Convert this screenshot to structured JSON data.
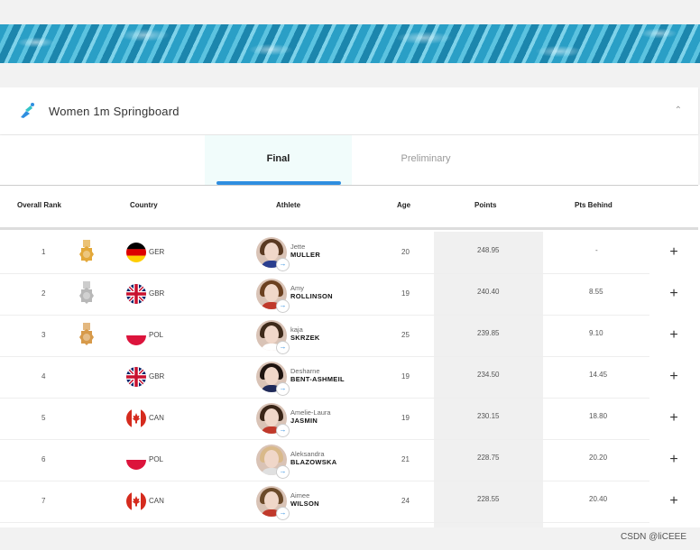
{
  "event": {
    "title": "Women 1m Springboard",
    "icon": "diving-icon",
    "collapse_icon": "chevron-up-icon"
  },
  "tabs": [
    {
      "label": "Final",
      "active": true
    },
    {
      "label": "Preliminary",
      "active": false
    }
  ],
  "table": {
    "headers": {
      "rank": "Overall Rank",
      "country": "Country",
      "athlete": "Athlete",
      "age": "Age",
      "points": "Points",
      "behind": "Pts Behind"
    },
    "rows": [
      {
        "rank": "1",
        "medal": "gold",
        "flag": "GER",
        "country": "GER",
        "first": "Jette",
        "last": "MULLER",
        "age": "20",
        "points": "248.95",
        "behind": "-",
        "hair": "#5a3a22",
        "shirt": "#2b3f8f"
      },
      {
        "rank": "2",
        "medal": "silver",
        "flag": "GBR",
        "country": "GBR",
        "first": "Amy",
        "last": "ROLLINSON",
        "age": "19",
        "points": "240.40",
        "behind": "8.55",
        "hair": "#6b4020",
        "shirt": "#c0392b"
      },
      {
        "rank": "3",
        "medal": "bronze",
        "flag": "POL",
        "country": "POL",
        "first": "kaja",
        "last": "SKRZEK",
        "age": "25",
        "points": "239.85",
        "behind": "9.10",
        "hair": "#3e2a1a",
        "shirt": "#ffffff"
      },
      {
        "rank": "4",
        "medal": "",
        "flag": "GBR",
        "country": "GBR",
        "first": "Desharne",
        "last": "BENT-ASHMEIL",
        "age": "19",
        "points": "234.50",
        "behind": "14.45",
        "hair": "#1e1410",
        "shirt": "#1f2a5a"
      },
      {
        "rank": "5",
        "medal": "",
        "flag": "CAN",
        "country": "CAN",
        "first": "Amelie-Laura",
        "last": "JASMIN",
        "age": "19",
        "points": "230.15",
        "behind": "18.80",
        "hair": "#3a2618",
        "shirt": "#c0392b"
      },
      {
        "rank": "6",
        "medal": "",
        "flag": "POL",
        "country": "POL",
        "first": "Aleksandra",
        "last": "BLAZOWSKA",
        "age": "21",
        "points": "228.75",
        "behind": "20.20",
        "hair": "#d9b98a",
        "shirt": "#e0e0e0"
      },
      {
        "rank": "7",
        "medal": "",
        "flag": "CAN",
        "country": "CAN",
        "first": "Aimee",
        "last": "WILSON",
        "age": "24",
        "points": "228.55",
        "behind": "20.40",
        "hair": "#6b4a2a",
        "shirt": "#c0392b"
      }
    ]
  },
  "footer": {
    "watermark": "CSDN @liCEEE"
  },
  "colors": {
    "accent": "#2f8ee0",
    "gold": "#e3a83a",
    "silver": "#b8b8b8",
    "bronze": "#d79a4a"
  }
}
